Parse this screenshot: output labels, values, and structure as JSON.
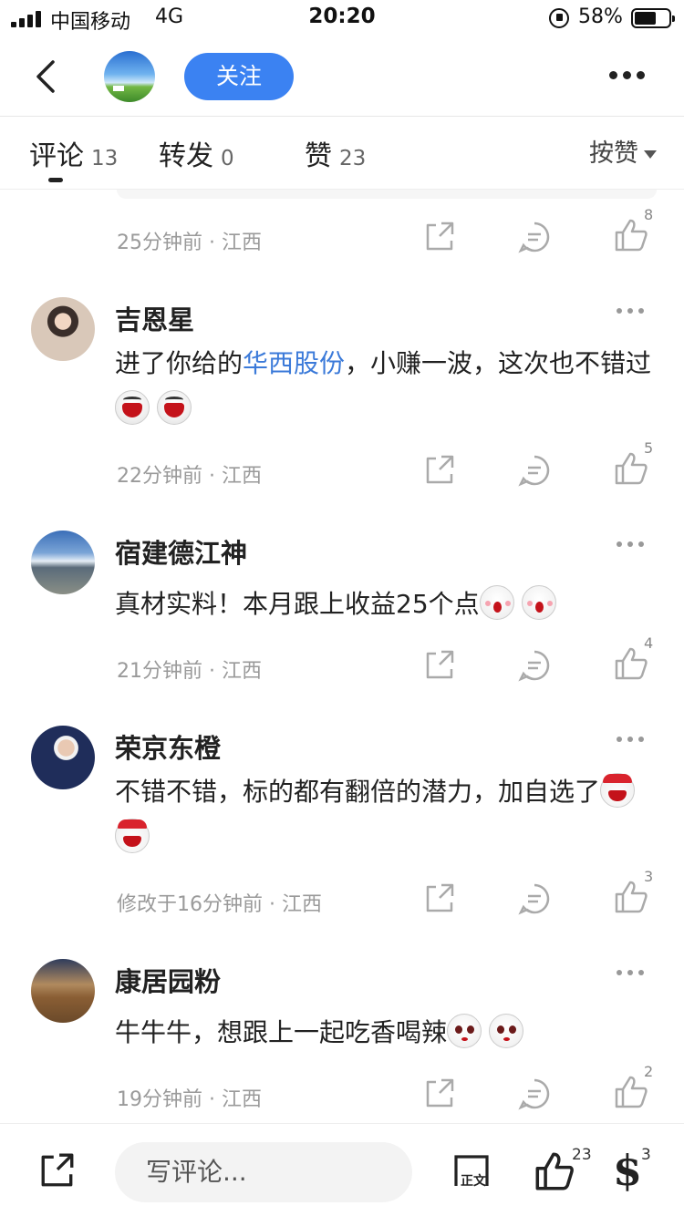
{
  "status": {
    "carrier": "中国移动",
    "network": "4G",
    "time": "20:20",
    "battery": "58%"
  },
  "header": {
    "follow_label": "关注"
  },
  "tabs": [
    {
      "label": "评论",
      "count": "13"
    },
    {
      "label": "转发",
      "count": "0"
    },
    {
      "label": "赞",
      "count": "23"
    }
  ],
  "sort_label": "按赞",
  "previous": {
    "meta": "25分钟前 · 江西",
    "likes": "8"
  },
  "comments": [
    {
      "name": "吉恩星",
      "text_pre": "进了你给的",
      "link": "华西股份",
      "text_post": "，小赚一波，这次也不错过",
      "emoji": "laugh",
      "meta": "22分钟前 · 江西",
      "likes": "5"
    },
    {
      "name": "宿建德江神",
      "text_pre": "真材实料！本月跟上收益25个点",
      "link": "",
      "text_post": "",
      "emoji": "cry",
      "meta": "21分钟前 · 江西",
      "likes": "4"
    },
    {
      "name": "荣京东橙",
      "text_pre": "不错不错，标的都有翻倍的潜力，加自选了",
      "link": "",
      "text_post": "",
      "emoji": "hat",
      "meta": "修改于16分钟前 · 江西",
      "likes": "3"
    },
    {
      "name": "康居园粉",
      "text_pre": "牛牛牛，想跟上一起吃香喝辣",
      "link": "",
      "text_post": "",
      "emoji": "eyes",
      "meta": "19分钟前 · 江西",
      "likes": "2"
    }
  ],
  "bottom": {
    "input_placeholder": "写评论...",
    "doc_label": "正文",
    "like_count": "23",
    "reward_symbol": "$",
    "reward_count": "3"
  },
  "colors": {
    "accent": "#3b82f2",
    "link": "#3b7ad9",
    "meta": "#9a9a9a"
  }
}
